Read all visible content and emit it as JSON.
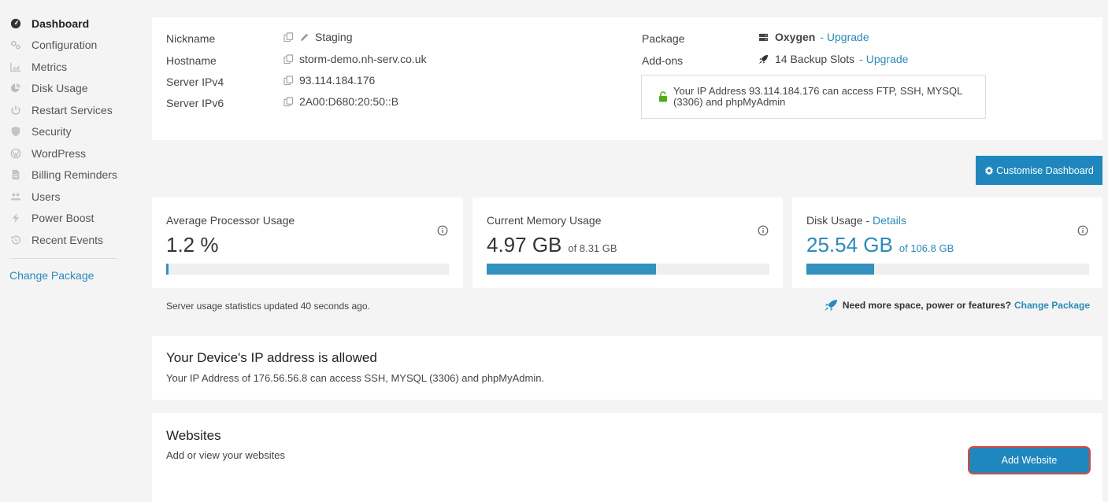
{
  "sidebar": {
    "items": [
      {
        "label": "Dashboard",
        "icon": "dashboard-icon",
        "active": true
      },
      {
        "label": "Configuration",
        "icon": "cogs-icon"
      },
      {
        "label": "Metrics",
        "icon": "area-chart-icon"
      },
      {
        "label": "Disk Usage",
        "icon": "pie-chart-icon"
      },
      {
        "label": "Restart Services",
        "icon": "power-icon"
      },
      {
        "label": "Security",
        "icon": "shield-icon"
      },
      {
        "label": "WordPress",
        "icon": "wordpress-icon"
      },
      {
        "label": "Billing Reminders",
        "icon": "invoice-icon"
      },
      {
        "label": "Users",
        "icon": "users-icon"
      },
      {
        "label": "Power Boost",
        "icon": "bolt-icon"
      },
      {
        "label": "Recent Events",
        "icon": "history-icon"
      }
    ],
    "change_package": "Change Package"
  },
  "server": {
    "nickname_label": "Nickname",
    "nickname_value": "Staging",
    "hostname_label": "Hostname",
    "hostname_value": "storm-demo.nh-serv.co.uk",
    "ipv4_label": "Server IPv4",
    "ipv4_value": "93.114.184.176",
    "ipv6_label": "Server IPv6",
    "ipv6_value": "2A00:D680:20:50::B",
    "package_label": "Package",
    "package_value": "Oxygen",
    "package_upgrade": "- Upgrade",
    "addons_label": "Add-ons",
    "addons_value": "14 Backup Slots",
    "addons_upgrade": "- Upgrade",
    "ip_access_notice": "Your IP Address 93.114.184.176 can access FTP, SSH, MYSQL (3306) and phpMyAdmin"
  },
  "toolbar": {
    "customise_label": "Customise Dashboard"
  },
  "usage": {
    "cpu": {
      "title": "Average Processor Usage",
      "value": "1.2 %",
      "percent": 0.4
    },
    "memory": {
      "title": "Current Memory Usage",
      "value": "4.97 GB",
      "of": "of 8.31 GB",
      "percent": 59.8
    },
    "disk": {
      "title": "Disk Usage",
      "title_sep": " - ",
      "details_link": "Details",
      "value": "25.54 GB",
      "of": "of 106.8 GB",
      "percent": 23.9
    }
  },
  "stats_updated": "Server usage statistics updated 40 seconds ago.",
  "need_more": {
    "text": "Need more space, power or features?",
    "link": "Change Package"
  },
  "device_ip": {
    "title": "Your Device's IP address is allowed",
    "text": "Your IP Address of 176.56.56.8 can access SSH, MYSQL (3306) and phpMyAdmin."
  },
  "websites": {
    "title": "Websites",
    "subtitle": "Add or view your websites",
    "add_label": "Add Website"
  },
  "colors": {
    "accent": "#1f87bd",
    "link": "#2a8ab8",
    "bar": "#3291bd",
    "highlight_border": "#d94a3d",
    "lock_green": "#4caf1a"
  }
}
